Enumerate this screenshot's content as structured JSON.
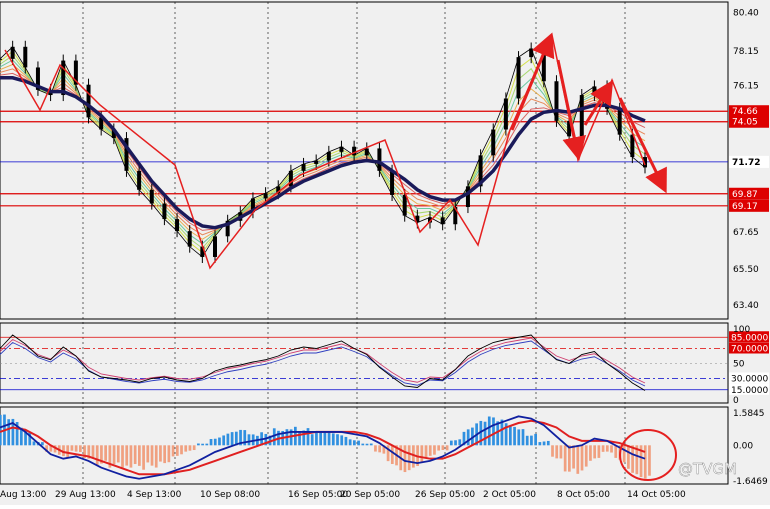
{
  "chart_data": {
    "type": "line",
    "price_axis": {
      "ticks": [
        "80.40",
        "78.15",
        "76.15",
        "74.66",
        "74.05",
        "71.72",
        "69.87",
        "69.17",
        "67.65",
        "65.50",
        "63.40"
      ],
      "min": 62.6,
      "max": 81.0
    },
    "price_tick_values": [
      80.4,
      78.15,
      76.15,
      71.72,
      67.65,
      65.5,
      63.4
    ],
    "levels": [
      {
        "label": "74.66",
        "value": 74.66,
        "color": "#dd0000"
      },
      {
        "label": "74.05",
        "value": 74.05,
        "color": "#dd0000"
      },
      {
        "label": "71.72",
        "value": 71.72,
        "color": "#0000cc"
      },
      {
        "label": "69.87",
        "value": 69.87,
        "color": "#dd0000"
      },
      {
        "label": "69.17",
        "value": 69.17,
        "color": "#dd0000"
      }
    ],
    "price_series": {
      "name": "price",
      "values": [
        77.7,
        78.4,
        77.2,
        75.9,
        75.6,
        77.6,
        76.2,
        74.3,
        73.6,
        73.1,
        71.2,
        70.1,
        69.3,
        68.4,
        67.7,
        66.8,
        66.2,
        67.4,
        68.3,
        68.8,
        69.6,
        69.9,
        70.3,
        71.2,
        71.6,
        71.8,
        72.3,
        72.6,
        72.1,
        72.5,
        71.2,
        69.8,
        68.6,
        68.2,
        68.5,
        68.1,
        69.1,
        70.3,
        72.1,
        73.6,
        75.4,
        77.8,
        78.3,
        76.4,
        74.1,
        73.2,
        75.6,
        76.1,
        74.8,
        73.3,
        72.0,
        71.4
      ]
    },
    "ema_series": {
      "name": "EMA",
      "values": [
        76.6,
        76.6,
        76.4,
        76.1,
        75.8,
        75.8,
        75.5,
        75.0,
        74.4,
        73.6,
        72.6,
        71.6,
        70.6,
        69.8,
        69.0,
        68.4,
        68.0,
        67.9,
        68.1,
        68.5,
        68.9,
        69.3,
        69.7,
        70.2,
        70.6,
        70.9,
        71.2,
        71.5,
        71.7,
        71.8,
        71.7,
        71.2,
        70.7,
        70.1,
        69.7,
        69.5,
        69.5,
        69.9,
        70.5,
        71.2,
        72.2,
        73.3,
        74.2,
        74.6,
        74.7,
        74.6,
        74.8,
        75.0,
        75.0,
        74.8,
        74.4,
        74.1
      ]
    },
    "osc1": {
      "axis_ticks": [
        "100",
        "50",
        "0"
      ],
      "levels": [
        {
          "label": "85.0000",
          "value": 85,
          "color": "#dd0000"
        },
        {
          "label": "70.0000",
          "value": 70,
          "color": "#dd0000"
        },
        {
          "label": "30.0000",
          "value": 30,
          "color": "#0000cc"
        },
        {
          "label": "15.0000",
          "value": 15,
          "color": "#0000cc"
        }
      ],
      "line1": [
        70,
        88,
        76,
        60,
        55,
        72,
        60,
        40,
        32,
        30,
        28,
        25,
        30,
        32,
        28,
        26,
        30,
        40,
        45,
        48,
        52,
        55,
        60,
        68,
        72,
        70,
        75,
        80,
        70,
        62,
        45,
        32,
        20,
        18,
        30,
        28,
        42,
        60,
        70,
        78,
        82,
        85,
        88,
        70,
        55,
        50,
        62,
        66,
        50,
        38,
        24,
        14
      ],
      "line2": [
        66,
        82,
        74,
        62,
        56,
        68,
        60,
        45,
        36,
        33,
        30,
        28,
        31,
        33,
        30,
        29,
        32,
        38,
        43,
        46,
        50,
        53,
        58,
        64,
        68,
        68,
        72,
        76,
        70,
        63,
        50,
        38,
        28,
        25,
        32,
        31,
        42,
        56,
        66,
        73,
        78,
        81,
        84,
        72,
        60,
        54,
        60,
        63,
        54,
        44,
        32,
        24
      ]
    },
    "osc2": {
      "axis_ticks": [
        "1.5845",
        "0.00",
        "-1.6469"
      ],
      "hist": [
        1.4,
        1.2,
        0.8,
        0.2,
        -0.4,
        -0.6,
        -0.3,
        -0.6,
        -0.9,
        -1.1,
        -1.3,
        -1.2,
        -1.0,
        -0.8,
        -0.5,
        -0.3,
        0.1,
        0.4,
        0.6,
        0.7,
        0.5,
        0.6,
        0.9,
        1.0,
        0.8,
        0.6,
        0.6,
        0.5,
        0.3,
        0.1,
        -0.4,
        -0.9,
        -1.2,
        -1.0,
        -0.6,
        -0.3,
        0.3,
        0.8,
        1.1,
        1.3,
        1.2,
        1.0,
        0.6,
        0.2,
        -0.6,
        -1.2,
        -1.3,
        -0.8,
        -0.4,
        -0.8,
        -1.3,
        -1.5
      ],
      "macd": [
        0.8,
        1.0,
        0.6,
        0.1,
        -0.4,
        -0.6,
        -0.5,
        -0.7,
        -1.0,
        -1.2,
        -1.4,
        -1.5,
        -1.4,
        -1.3,
        -1.1,
        -0.9,
        -0.6,
        -0.3,
        -0.1,
        0.1,
        0.2,
        0.3,
        0.5,
        0.6,
        0.6,
        0.6,
        0.6,
        0.6,
        0.5,
        0.4,
        0.1,
        -0.3,
        -0.7,
        -0.8,
        -0.7,
        -0.5,
        -0.2,
        0.2,
        0.6,
        0.9,
        1.1,
        1.3,
        1.2,
        0.9,
        0.4,
        -0.1,
        0.0,
        0.3,
        0.2,
        -0.1,
        -0.4,
        -0.6
      ],
      "signal": [
        0.6,
        0.8,
        0.7,
        0.4,
        0.0,
        -0.3,
        -0.4,
        -0.5,
        -0.7,
        -0.9,
        -1.1,
        -1.3,
        -1.3,
        -1.3,
        -1.2,
        -1.1,
        -0.9,
        -0.7,
        -0.5,
        -0.3,
        -0.1,
        0.1,
        0.3,
        0.4,
        0.5,
        0.6,
        0.6,
        0.6,
        0.6,
        0.5,
        0.3,
        0.0,
        -0.3,
        -0.5,
        -0.6,
        -0.6,
        -0.4,
        -0.1,
        0.2,
        0.5,
        0.8,
        1.0,
        1.1,
        1.0,
        0.8,
        0.4,
        0.2,
        0.2,
        0.2,
        0.1,
        -0.1,
        -0.3
      ]
    },
    "time_ticks": [
      "Aug 13:00",
      "29 Aug 13:00",
      "4 Sep 13:00",
      "10 Sep 08:00",
      "16 Sep 05:00",
      "20 Sep 05:00",
      "26 Sep 05:00",
      "2 Oct 05:00",
      "8 Oct 05:00",
      "14 Oct 05:00"
    ],
    "grid": true
  },
  "watermark": "@TVGM"
}
